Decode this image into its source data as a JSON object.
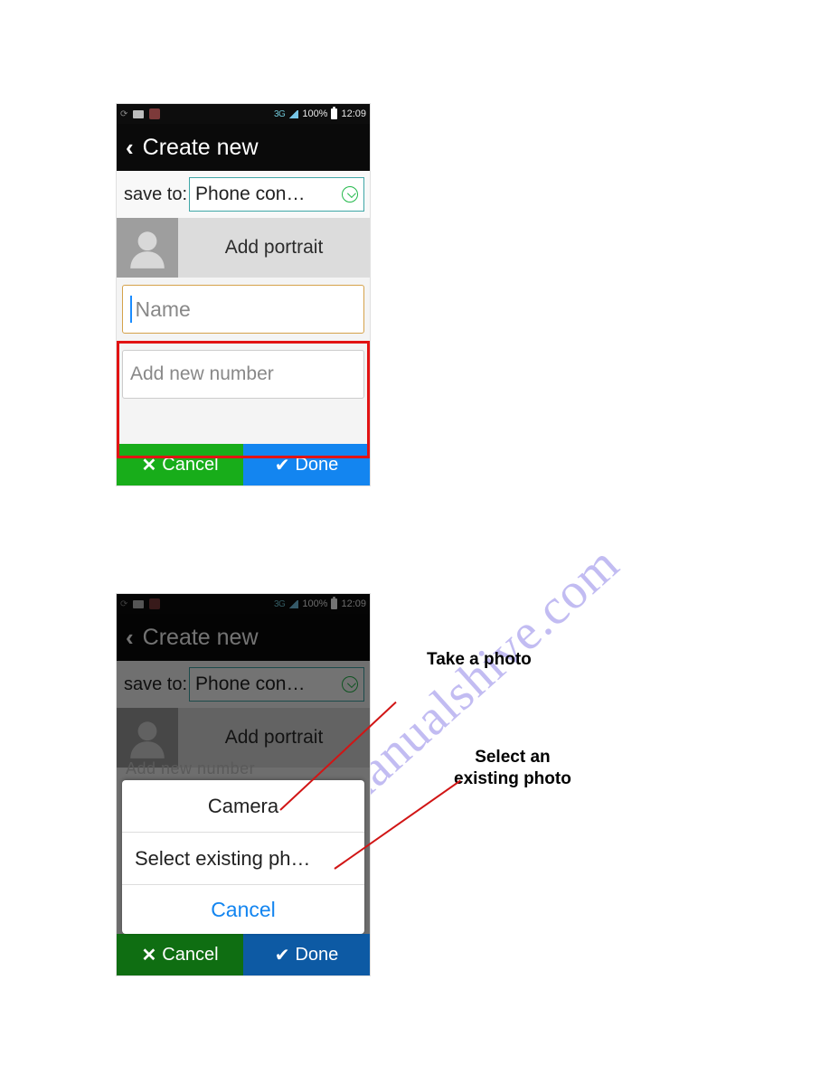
{
  "watermark": "manualshive.com",
  "status": {
    "network": "3G",
    "battery": "100%",
    "time": "12:09"
  },
  "title": "Create new",
  "save": {
    "label": "save to:",
    "value": "Phone con…"
  },
  "portrait": {
    "button": "Add portrait"
  },
  "inputs": {
    "name_placeholder": "Name",
    "number_placeholder": "Add new number"
  },
  "buttons": {
    "cancel": "Cancel",
    "done": "Done"
  },
  "dialog": {
    "camera": "Camera",
    "select": "Select existing ph…",
    "cancel": "Cancel",
    "peek_bg": "Add new number"
  },
  "annotations": {
    "take_photo": "Take a photo",
    "select_photo_l1": "Select an",
    "select_photo_l2": "existing photo"
  }
}
